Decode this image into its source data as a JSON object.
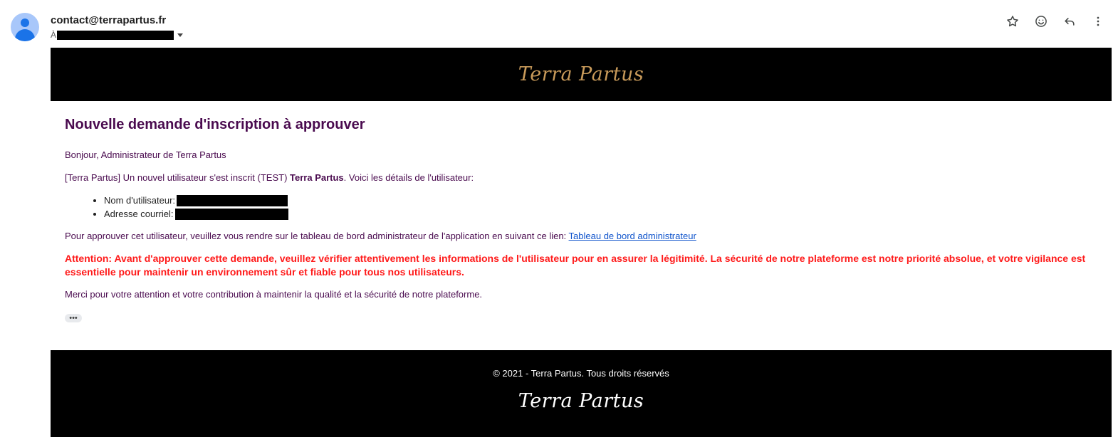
{
  "header": {
    "sender": "contact@terrapartus.fr",
    "to_label": "À"
  },
  "actions": [
    {
      "name": "star-icon"
    },
    {
      "name": "emoji-icon"
    },
    {
      "name": "reply-icon"
    },
    {
      "name": "more-vert-icon"
    }
  ],
  "email": {
    "logo_text": "Terra Partus",
    "title": "Nouvelle demande d'inscription à approuver",
    "greeting": "Bonjour, Administrateur de Terra Partus",
    "intro_prefix": "[Terra Partus] Un nouvel utilisateur s'est inscrit (TEST) ",
    "intro_bold": "Terra Partus",
    "intro_suffix": ". Voici les détails de l'utilisateur:",
    "details": [
      {
        "label": "Nom d'utilisateur:"
      },
      {
        "label": "Adresse courriel:"
      }
    ],
    "approve_text": "Pour approuver cet utilisateur, veuillez vous rendre sur le tableau de bord administrateur de l'application en suivant ce lien: ",
    "approve_link": "Tableau de bord administrateur",
    "warning": "Attention: Avant d'approuver cette demande, veuillez vérifier attentivement les informations de l'utilisateur pour en assurer la légitimité. La sécurité de notre plateforme est notre priorité absolue, et votre vigilance est essentielle pour maintenir un environnement sûr et fiable pour tous nos utilisateurs.",
    "thanks": "Merci pour votre attention et votre contribution à maintenir la qualité et la sécurité de notre plateforme.",
    "ellipsis": "•••",
    "footer_copyright": "© 2021 - Terra Partus. Tous droits réservés",
    "footer_logo_text": "Terra Partus"
  },
  "colors": {
    "heading": "#4a0b4f",
    "warning": "#ff1a1a",
    "link": "#1155cc",
    "logo_gold": "#c89a5a"
  }
}
